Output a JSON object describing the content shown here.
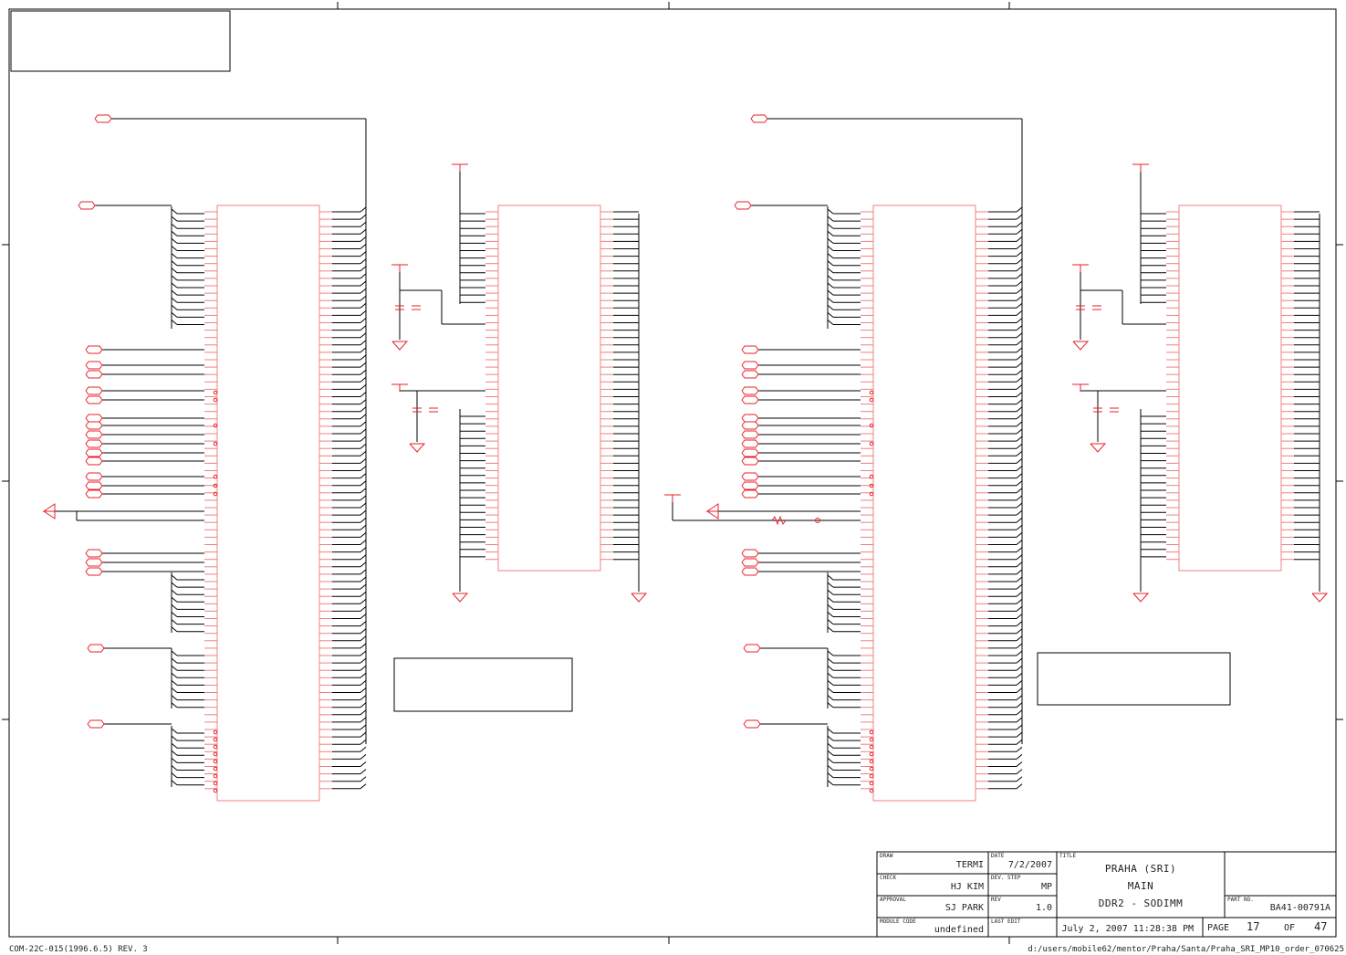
{
  "sheet": {
    "form_id": "COM-22C-015(1996.6.5) REV. 3",
    "file_path": "d:/users/mobile62/mentor/Praha/Santa/Praha_SRI_MP10_order_070625"
  },
  "title_block": {
    "draw_label": "DRAW",
    "draw_value": "TERMI",
    "check_label": "CHECK",
    "check_value": "HJ KIM",
    "approval_label": "APPROVAL",
    "approval_value": "SJ PARK",
    "module_code_label": "MODULE CODE",
    "module_code_value": "undefined",
    "date_label": "DATE",
    "date_value": "7/2/2007",
    "dev_step_label": "DEV. STEP",
    "dev_step_value": "MP",
    "rev_label": "REV",
    "rev_value": "1.0",
    "last_edit_label": "LAST EDIT",
    "last_edit_value": "July 2, 2007  11:28:38 PM",
    "title_label": "TITLE",
    "title_line1": "PRAHA (SRI)",
    "title_line2": "MAIN",
    "title_line3": "DDR2 - SODIMM",
    "part_no_label": "PART NO.",
    "part_no_value": "BA41-00791A",
    "page_label": "PAGE",
    "page_value": "17",
    "of_label": "OF",
    "of_value": "47"
  },
  "colors": {
    "symbol": "#e8202a",
    "wire": "#000000",
    "frame": "#000000",
    "chip_outline": "#f08080"
  }
}
